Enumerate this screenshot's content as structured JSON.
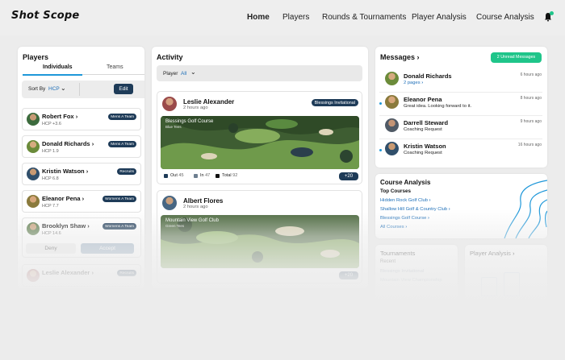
{
  "header": {
    "logo": "Shot Scope",
    "nav": [
      "Home",
      "Players",
      "Rounds & Tournaments",
      "Player Analysis",
      "Course Analysis"
    ],
    "active": "Home"
  },
  "players": {
    "title": "Players",
    "tabs": [
      "Individuals",
      "Teams"
    ],
    "sort_label": "Sort By",
    "sort_value": "HCP",
    "edit_label": "Edit",
    "list": [
      {
        "name": "Robert Fox",
        "hcp": "HCP +3.6",
        "team": "Mens A Team"
      },
      {
        "name": "Donald Richards",
        "hcp": "HCP 1.9",
        "team": "Mens A Team"
      },
      {
        "name": "Kristin Watson",
        "hcp": "HCP 6.8",
        "team": "Recruits"
      },
      {
        "name": "Eleanor Pena",
        "hcp": "HCP 7.7",
        "team": "Womens A Team"
      },
      {
        "name": "Brooklyn Shaw",
        "hcp": "HCP 14.6",
        "team": "Womens A Team"
      },
      {
        "name": "Leslie Alexander",
        "hcp": "",
        "team": "Recruits"
      }
    ],
    "deny_label": "Deny",
    "accept_label": "Accept"
  },
  "activity": {
    "title": "Activity",
    "filter_label": "Player",
    "filter_value": "All",
    "posts": [
      {
        "name": "Leslie Alexander",
        "time": "2 hours ago",
        "event": "Blessings Invitational",
        "course": "Blessings Golf Course",
        "tee": "Blue Tees",
        "out_label": "Out",
        "out": "45",
        "in_label": "In",
        "in": "47",
        "total_label": "Total",
        "total": "92",
        "plus": "+20"
      },
      {
        "name": "Albert Flores",
        "time": "2 hours ago",
        "event": "",
        "course": "Mountain View Golf Club",
        "tee": "Green Tees",
        "plus": "+20"
      }
    ]
  },
  "messages": {
    "title": "Messages",
    "unread_label": "2 Unread Messages",
    "items": [
      {
        "name": "Donald Richards",
        "text": "2 pages",
        "time": "6 hours ago",
        "unread": false,
        "link": true
      },
      {
        "name": "Eleanor Pena",
        "text": "Great idea. Looking forward to it.",
        "time": "8 hours ago",
        "unread": true,
        "link": false
      },
      {
        "name": "Darrell Steward",
        "text": "Coaching Request",
        "time": "9 hours ago",
        "unread": false,
        "link": false
      },
      {
        "name": "Kristin Watson",
        "text": "Coaching Request",
        "time": "16 hours ago",
        "unread": true,
        "link": false
      }
    ]
  },
  "course_analysis": {
    "title": "Course Analysis",
    "subtitle": "Top Courses",
    "courses": [
      "Hidden Rock Golf Club",
      "Shallow Hill Golf & Country Club",
      "Blessings Golf Course",
      "All Courses"
    ]
  },
  "tournaments": {
    "title": "Tournaments",
    "recent_label": "Recent",
    "items": [
      "Blessings Invitational",
      "Mountain View Championship"
    ]
  },
  "player_analysis": {
    "title": "Player Analysis"
  },
  "colors": {
    "navy": "#1e3b58",
    "green": "#1fc58a",
    "blue": "#1e97d9",
    "link": "#1e6fb8"
  }
}
